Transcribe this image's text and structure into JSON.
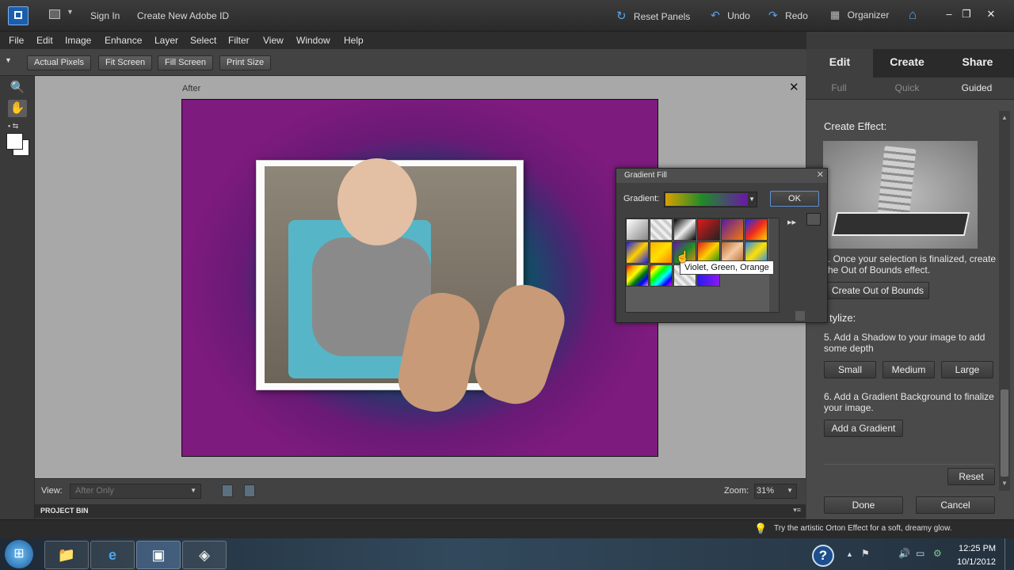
{
  "titlebar": {
    "sign_in": "Sign In",
    "create_id": "Create New Adobe ID",
    "reset_panels": "Reset Panels",
    "undo": "Undo",
    "redo": "Redo",
    "organizer": "Organizer"
  },
  "menu": [
    "File",
    "Edit",
    "Image",
    "Enhance",
    "Layer",
    "Select",
    "Filter",
    "View",
    "Window",
    "Help"
  ],
  "options": [
    "Actual Pixels",
    "Fit Screen",
    "Fill Screen",
    "Print Size"
  ],
  "document": {
    "tab": "After"
  },
  "bottom": {
    "view_label": "View:",
    "view_value": "After Only",
    "zoom_label": "Zoom:",
    "zoom_value": "31%",
    "project_bin": "PROJECT BIN"
  },
  "panel": {
    "tabs": [
      "Edit",
      "Create",
      "Share"
    ],
    "subtabs": [
      "Full",
      "Quick",
      "Guided"
    ],
    "create_effect": "Create Effect:",
    "step_text_1": ". Once your selection is finalized, create",
    "step_text_2": "he Out of Bounds effect.",
    "create_oob": "Create Out of Bounds",
    "stylize": "tylize:",
    "step5": "5. Add a Shadow to your image to add some depth",
    "small": "Small",
    "medium": "Medium",
    "large": "Large",
    "step6": "6. Add a Gradient Background to finalize your image.",
    "add_gradient": "Add a Gradient",
    "reset": "Reset",
    "done": "Done",
    "cancel": "Cancel"
  },
  "dialog": {
    "title": "Gradient Fill",
    "gradient_label": "Gradient:",
    "ok": "OK",
    "tooltip": "Violet, Green, Orange"
  },
  "status": {
    "tip": "Try the artistic Orton Effect for a soft, dreamy glow."
  },
  "clock": {
    "time": "12:25 PM",
    "date": "10/1/2012"
  },
  "colors": {
    "panel_bg": "#4a4a4a",
    "workspace_bg": "#a8a8a8",
    "accent_blue": "#3e8ed0",
    "canvas_purple": "#7e1b7e",
    "canvas_green": "#0c7a3d"
  }
}
